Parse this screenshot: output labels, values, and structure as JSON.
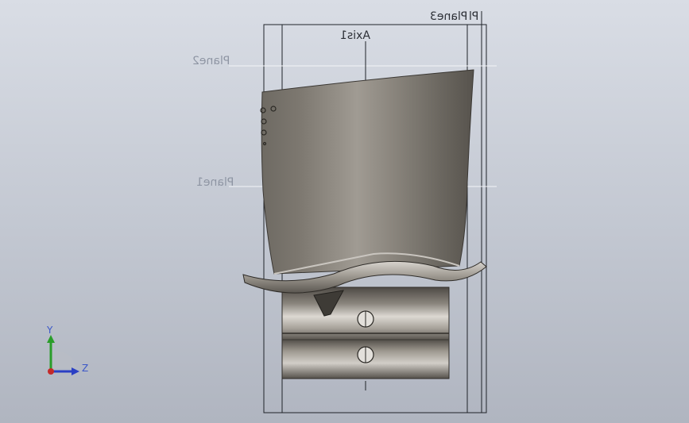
{
  "viewport": {
    "name": "graphics-area"
  },
  "reference_geometry": {
    "axis_label": "Axis1",
    "plane_labels": {
      "plane1": "Plane1",
      "plane2": "Plane2",
      "plane3": "Plane3",
      "plane_overlap": "Pl"
    }
  },
  "triad": {
    "y_label": "Y",
    "z_label": "Z"
  },
  "colors": {
    "background_top": "#d9dde5",
    "background_bottom": "#b0b5c0",
    "blade_light": "#aaa59d",
    "blade_dark": "#5c5852",
    "sketch_lines": "#1f2329",
    "axis_y": "#2a9d2a",
    "axis_z": "#2a3fc4",
    "axis_x": "#c42a2a"
  }
}
